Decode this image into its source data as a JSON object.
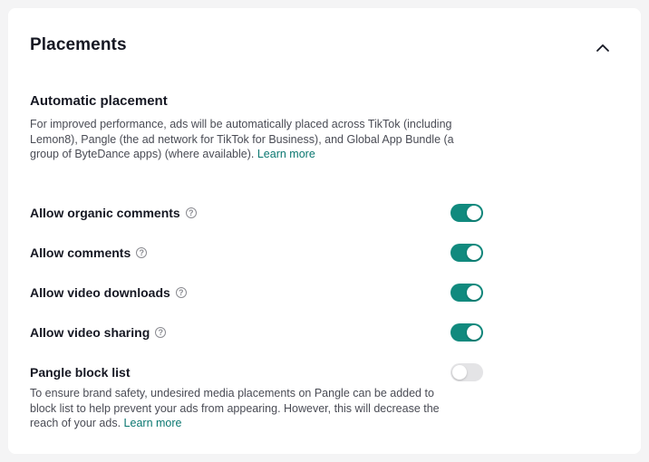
{
  "card": {
    "title": "Placements"
  },
  "automatic_placement": {
    "title": "Automatic placement",
    "description": "For improved performance, ads will be automatically placed across TikTok (including Lemon8), Pangle (the ad network for TikTok for Business), and Global App Bundle (a group of ByteDance apps) (where available).",
    "learn_more": "Learn more"
  },
  "settings": [
    {
      "label": "Allow organic comments",
      "help": "?",
      "enabled": true
    },
    {
      "label": "Allow comments",
      "help": "?",
      "enabled": true
    },
    {
      "label": "Allow video downloads",
      "help": "?",
      "enabled": true
    },
    {
      "label": "Allow video sharing",
      "help": "?",
      "enabled": true
    },
    {
      "label": "Pangle block list",
      "enabled": false
    }
  ],
  "pangle": {
    "description": "To ensure brand safety, undesired media placements on Pangle can be added to block list to help prevent your ads from appearing. However, this will decrease the reach of your ads.",
    "learn_more": "Learn more"
  },
  "colors": {
    "toggle_on": "#118a7e",
    "toggle_off": "#e4e4e6",
    "link": "#0a7770"
  },
  "icons": {
    "collapse": "chevron-up-icon",
    "help": "question-circle-icon"
  }
}
